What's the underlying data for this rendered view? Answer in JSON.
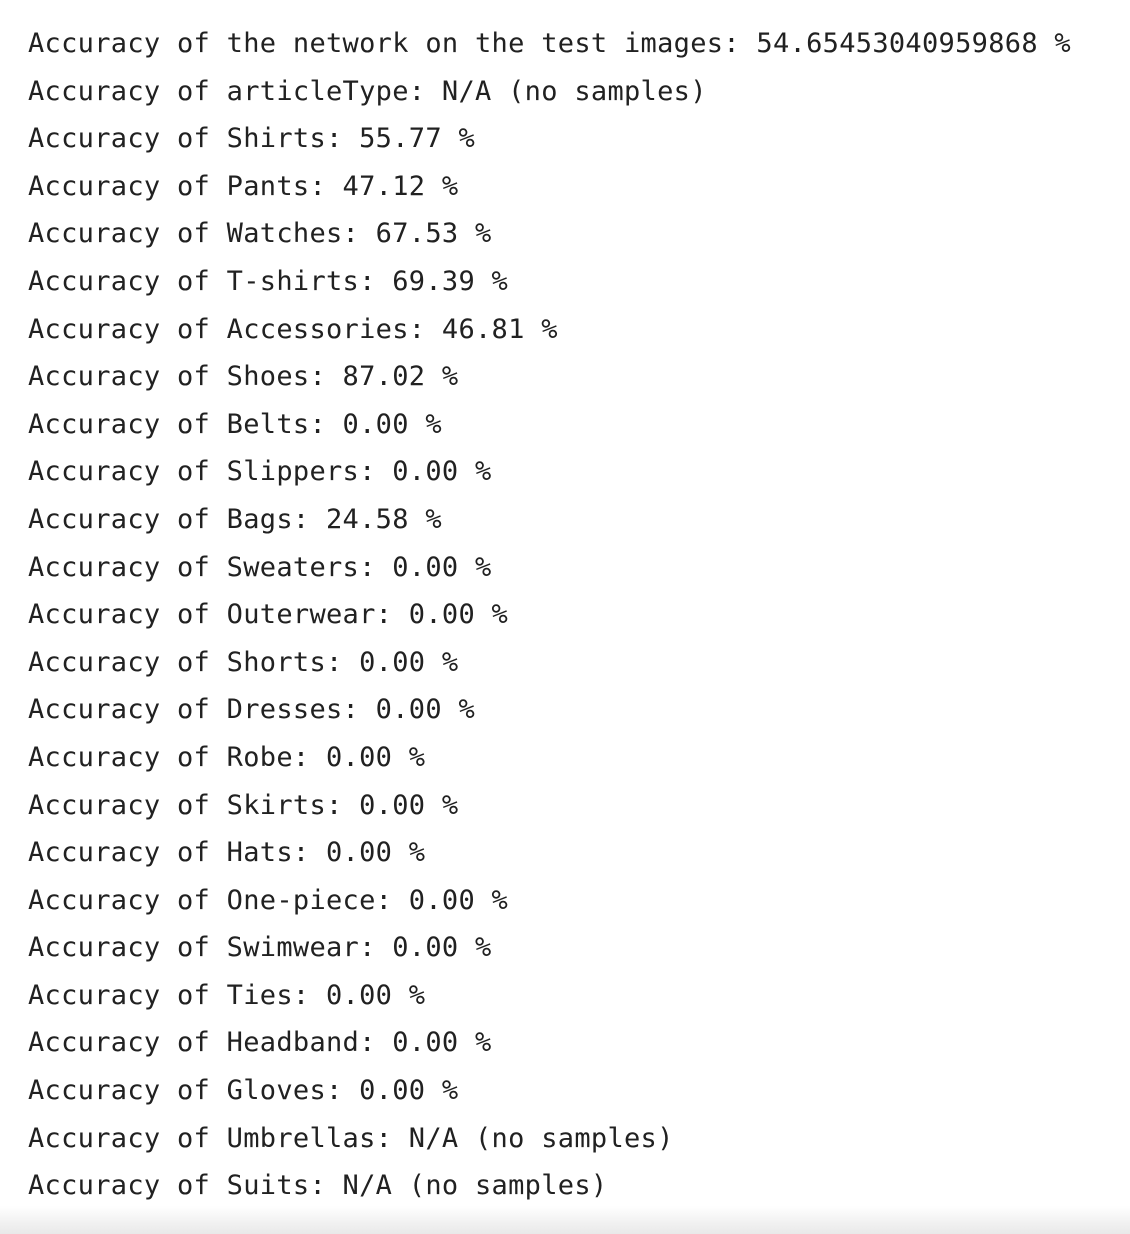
{
  "output": {
    "lines": [
      "Accuracy of the network on the test images: 54.65453040959868 %",
      "Accuracy of articleType: N/A (no samples)",
      "Accuracy of Shirts: 55.77 %",
      "Accuracy of Pants: 47.12 %",
      "Accuracy of Watches: 67.53 %",
      "Accuracy of T-shirts: 69.39 %",
      "Accuracy of Accessories: 46.81 %",
      "Accuracy of Shoes: 87.02 %",
      "Accuracy of Belts: 0.00 %",
      "Accuracy of Slippers: 0.00 %",
      "Accuracy of Bags: 24.58 %",
      "Accuracy of Sweaters: 0.00 %",
      "Accuracy of Outerwear: 0.00 %",
      "Accuracy of Shorts: 0.00 %",
      "Accuracy of Dresses: 0.00 %",
      "Accuracy of Robe: 0.00 %",
      "Accuracy of Skirts: 0.00 %",
      "Accuracy of Hats: 0.00 %",
      "Accuracy of One-piece: 0.00 %",
      "Accuracy of Swimwear: 0.00 %",
      "Accuracy of Ties: 0.00 %",
      "Accuracy of Headband: 0.00 %",
      "Accuracy of Gloves: 0.00 %",
      "Accuracy of Umbrellas: N/A (no samples)",
      "Accuracy of Suits: N/A (no samples)"
    ]
  },
  "colors": {
    "text": "#212121",
    "background": "#ffffff"
  }
}
